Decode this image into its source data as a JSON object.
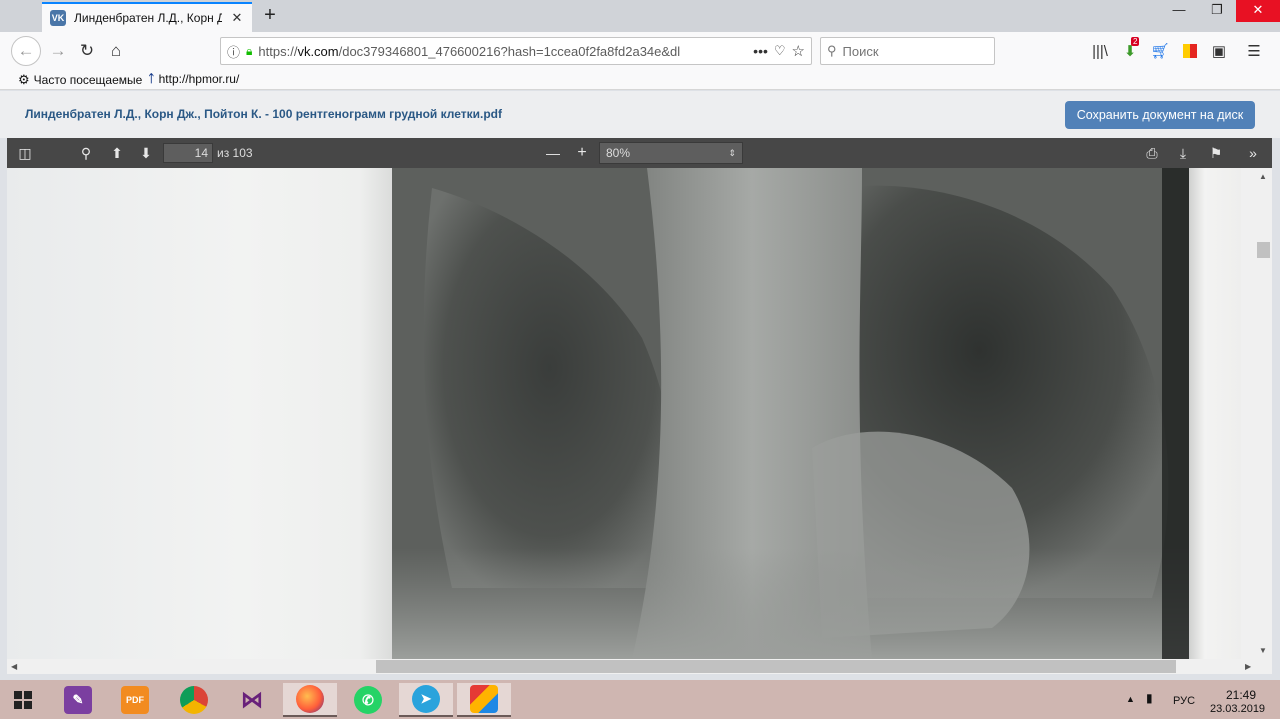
{
  "browser": {
    "tab_title": "Линденбратен Л.Д., Корн Дж.",
    "tab_favicon_text": "VK",
    "url_prefix": "https://",
    "url_host": "vk.com",
    "url_path": "/doc379346801_476600216?hash=1ccea0f2fa8fd2a34e&dl",
    "search_placeholder": "Поиск",
    "bookmarks": [
      {
        "icon": "gear-icon",
        "label": "Часто посещаемые"
      },
      {
        "icon": "hpmor-icon",
        "label": "http://hpmor.ru/"
      }
    ],
    "downloads_badge": "2"
  },
  "doc": {
    "title": "Линденбратен Л.Д., Корн Дж., Пойтон К. - 100 рентгенограмм грудной клетки.pdf",
    "save_label": "Сохранить документ на диск"
  },
  "pdf_toolbar": {
    "current_page": "14",
    "page_count_label": "из 103",
    "zoom": "80%"
  },
  "taskbar": {
    "apps": [
      {
        "name": "onenote-app",
        "label": ""
      },
      {
        "name": "pdf-app",
        "label": "PDF"
      },
      {
        "name": "chrome-app",
        "label": ""
      },
      {
        "name": "visual-studio-app",
        "label": ""
      },
      {
        "name": "firefox-app",
        "label": ""
      },
      {
        "name": "whatsapp-app",
        "label": ""
      },
      {
        "name": "telegram-app",
        "label": ""
      },
      {
        "name": "anydesk-app",
        "label": ""
      }
    ],
    "language": "РУС",
    "time": "21:49",
    "date": "23.03.2019"
  },
  "colors": {
    "vk_blue": "#5181b8",
    "vk_link": "#2a5885",
    "pdf_toolbar": "#474747",
    "taskbar": "#cfb6b1"
  }
}
